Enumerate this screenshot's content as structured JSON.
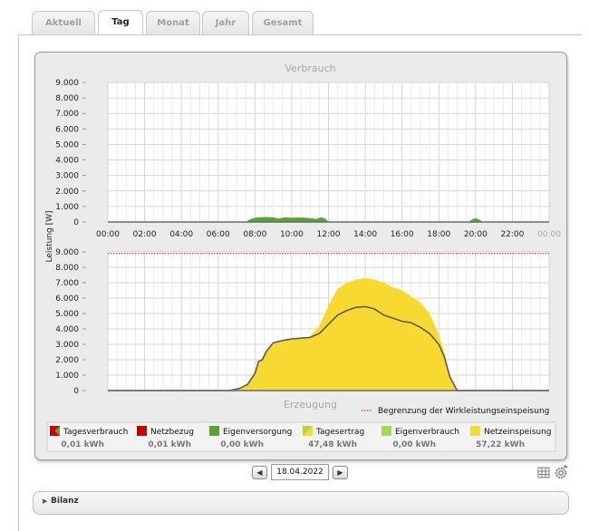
{
  "tabs": [
    {
      "label": "Aktuell",
      "active": false
    },
    {
      "label": "Tag",
      "active": true
    },
    {
      "label": "Monat",
      "active": false
    },
    {
      "label": "Jahr",
      "active": false
    },
    {
      "label": "Gesamt",
      "active": false
    }
  ],
  "chart_data": [
    {
      "type": "area",
      "title": "Verbrauch",
      "ylabel": "Leistung [W]",
      "x_ticks": [
        "00:00",
        "02:00",
        "04:00",
        "06:00",
        "08:00",
        "10:00",
        "12:00",
        "14:00",
        "16:00",
        "18:00",
        "20:00",
        "22:00",
        "00:00"
      ],
      "y_ticks": [
        "9.000",
        "8.000",
        "7.000",
        "6.000",
        "5.000",
        "4.000",
        "3.000",
        "2.000",
        "1.000",
        "0"
      ],
      "ylim": [
        0,
        9000
      ],
      "xlim": [
        0,
        24
      ],
      "grid": true,
      "series": [
        {
          "name": "Eigenversorgung",
          "color": "#5aa532",
          "x": [
            0,
            7.0,
            7.5,
            7.7,
            8.0,
            8.5,
            9.0,
            9.3,
            9.6,
            10.0,
            10.5,
            11.0,
            11.3,
            11.6,
            11.8,
            12.0,
            19.6,
            19.8,
            20.0,
            20.2,
            20.4,
            24
          ],
          "y": [
            0,
            0,
            0,
            150,
            280,
            320,
            300,
            220,
            300,
            280,
            300,
            250,
            200,
            300,
            250,
            0,
            0,
            150,
            260,
            150,
            0,
            0
          ]
        }
      ]
    },
    {
      "type": "area",
      "title": "Erzeugung",
      "y_ticks": [
        "9.000",
        "8.000",
        "7.000",
        "6.000",
        "5.000",
        "4.000",
        "3.000",
        "2.000",
        "1.000",
        "0"
      ],
      "ylim": [
        0,
        9000
      ],
      "xlim": [
        0,
        24
      ],
      "grid": true,
      "series": [
        {
          "name": "Netzeinspeisung",
          "color": "#f7d931",
          "x": [
            0,
            6.6,
            7.2,
            7.6,
            8.0,
            8.2,
            8.4,
            8.6,
            9.0,
            9.5,
            10.0,
            10.5,
            11.0,
            11.5,
            12.0,
            12.5,
            13.0,
            13.5,
            14.0,
            14.5,
            15.0,
            15.5,
            16.0,
            16.5,
            17.0,
            17.5,
            18.0,
            18.3,
            18.6,
            19.0,
            24
          ],
          "y": [
            0,
            0,
            150,
            400,
            1100,
            1900,
            2000,
            2500,
            3100,
            3250,
            3350,
            3400,
            3500,
            4200,
            5500,
            6600,
            7000,
            7200,
            7300,
            7200,
            7000,
            6700,
            6500,
            6100,
            5700,
            5000,
            3600,
            2500,
            1000,
            0,
            0
          ]
        },
        {
          "name": "Tagesertrag",
          "color": "#5a5a5a",
          "line": true,
          "x": [
            0,
            6.6,
            7.2,
            7.6,
            8.0,
            8.2,
            8.4,
            8.6,
            9.0,
            9.5,
            10.0,
            10.5,
            11.0,
            11.5,
            12.0,
            12.5,
            13.0,
            13.5,
            14.0,
            14.5,
            15.0,
            15.5,
            16.0,
            16.5,
            17.0,
            17.5,
            18.0,
            18.3,
            18.6,
            19.0,
            24
          ],
          "y": [
            0,
            0,
            150,
            400,
            1100,
            1900,
            2000,
            2500,
            3100,
            3250,
            3350,
            3400,
            3450,
            3700,
            4300,
            4900,
            5200,
            5400,
            5450,
            5300,
            4900,
            4700,
            4500,
            4400,
            4100,
            3700,
            3000,
            2200,
            900,
            0,
            0
          ]
        },
        {
          "name": "Begrenzung der Wirkleistungseinspeisung",
          "color": "#d81a1a",
          "dotted": true,
          "x": [
            0,
            24
          ],
          "y": [
            8900,
            8900
          ]
        }
      ]
    }
  ],
  "limit_label": "Begrenzung der Wirkleistungseinspeisung",
  "legend": [
    {
      "label": "Tagesverbrauch",
      "value": "0,01 kWh",
      "icon": "split-red-green"
    },
    {
      "label": "Netzbezug",
      "value": "0,01 kWh",
      "color": "#cc0000"
    },
    {
      "label": "Eigenversorgung",
      "value": "0,00 kWh",
      "color": "#5aa532"
    },
    {
      "label": "Tagesertrag",
      "value": "47,48 kWh",
      "icon": "split-yellow-green"
    },
    {
      "label": "Eigenverbrauch",
      "value": "0,00 kWh",
      "color": "#a9d84a"
    },
    {
      "label": "Netzeinspeisung",
      "value": "57,22 kWh",
      "color": "#f7d931"
    }
  ],
  "date": {
    "value": "18.04.2022",
    "prev_icon": "triangle-left-icon",
    "next_icon": "triangle-right-icon"
  },
  "tools": {
    "icons": [
      "table-icon",
      "settings-icon"
    ]
  },
  "bilanz": {
    "label": "Bilanz",
    "icon": "triangle-right-icon"
  }
}
